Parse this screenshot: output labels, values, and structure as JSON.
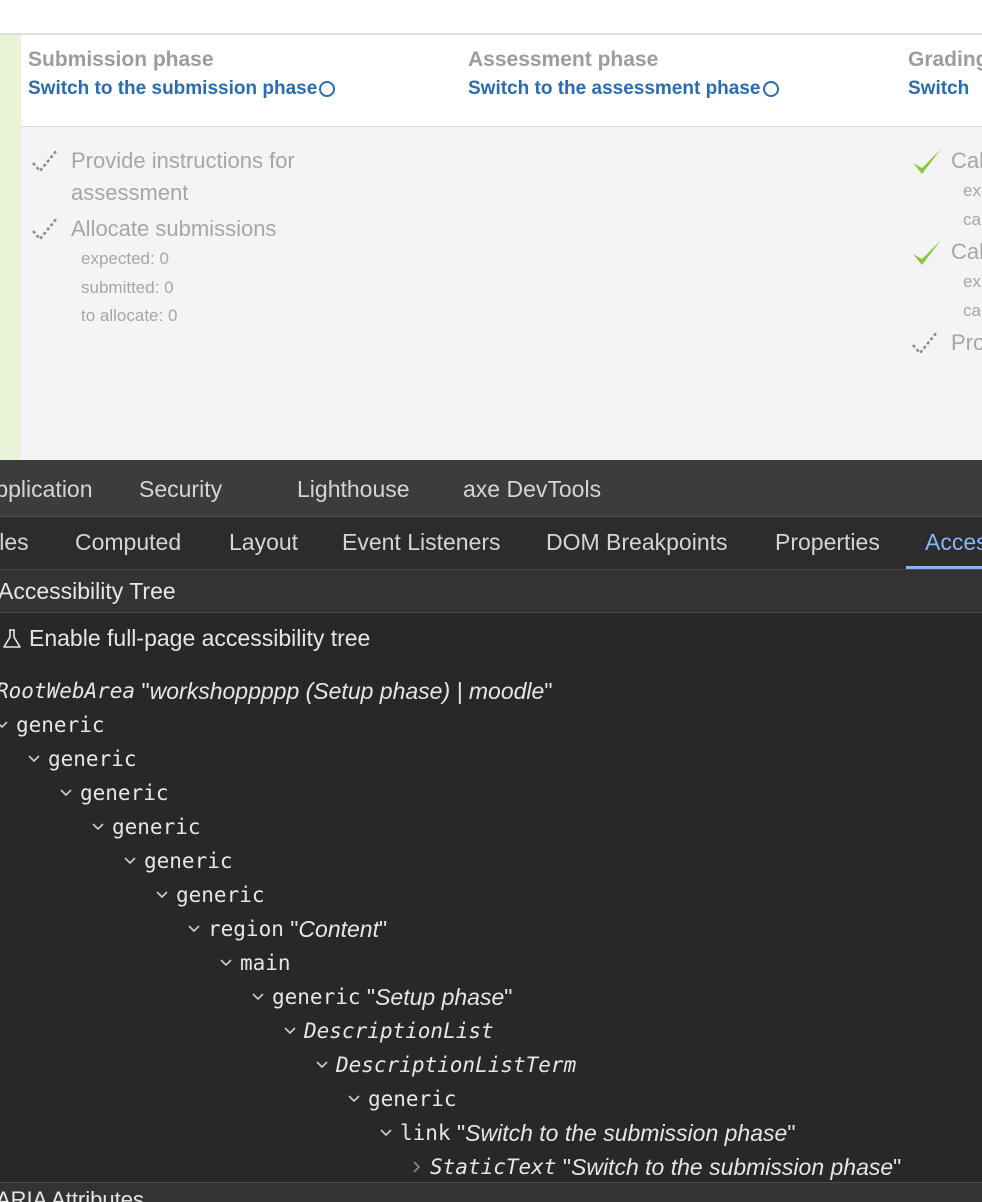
{
  "phases": [
    {
      "title": "Submission phase",
      "switch_label": "Switch to the submission phase"
    },
    {
      "title": "Assessment phase",
      "switch_label": "Switch to the assessment phase"
    },
    {
      "title": "Grading evaluation phase",
      "switch_label": "Switch"
    }
  ],
  "submission_tasks": [
    {
      "label_line1": "Provide instructions for",
      "label_line2": "assessment"
    },
    {
      "label_line1": "Allocate submissions",
      "details": [
        "expected: 0",
        "submitted: 0",
        "to allocate: 0"
      ]
    }
  ],
  "grading_tasks": [
    {
      "label": "Calculate",
      "details": [
        "expected",
        "calculated"
      ]
    },
    {
      "label": "Calculate",
      "details": [
        "expected",
        "calculated"
      ]
    },
    {
      "label": "Provide"
    }
  ],
  "devtools": {
    "main_tabs": [
      "Application",
      "Security",
      "Lighthouse",
      "axe DevTools"
    ],
    "sub_tabs": [
      "Styles",
      "Computed",
      "Layout",
      "Event Listeners",
      "DOM Breakpoints",
      "Properties",
      "Accessibility"
    ],
    "pane_title": "Accessibility Tree",
    "enable_label": "Enable full-page accessibility tree",
    "tree": [
      {
        "role": "RootWebArea",
        "name": "workshoppppp (Setup phase) | moodle"
      },
      {
        "role": "generic"
      },
      {
        "role": "generic"
      },
      {
        "role": "generic"
      },
      {
        "role": "generic"
      },
      {
        "role": "generic"
      },
      {
        "role": "generic"
      },
      {
        "role": "region",
        "name": "Content"
      },
      {
        "role": "main"
      },
      {
        "role": "generic",
        "name": "Setup phase"
      },
      {
        "role": "DescriptionList"
      },
      {
        "role": "DescriptionListTerm"
      },
      {
        "role": "generic"
      },
      {
        "role": "link",
        "name": "Switch to the submission phase"
      },
      {
        "role": "StaticText",
        "name": "Switch to the submission phase"
      }
    ],
    "footer_label": "ARIA Attributes"
  },
  "colors": {
    "accent_link": "#2b6cb0",
    "done_check": "#8cc63f",
    "devtools_active": "#8ab4f8"
  }
}
